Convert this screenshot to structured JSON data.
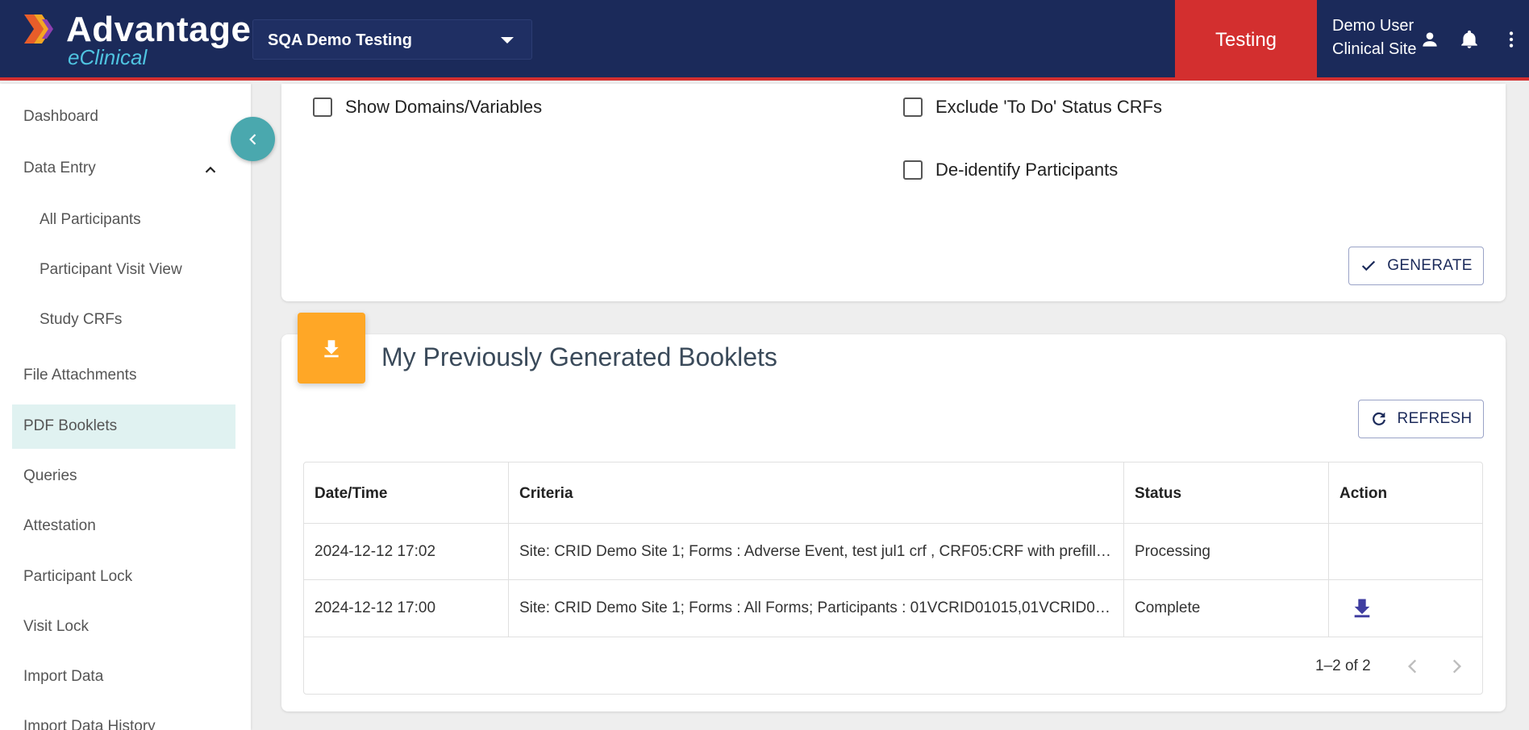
{
  "header": {
    "logo_title": "Advantage",
    "logo_subtitle": "eClinical",
    "study_selector": "SQA Demo Testing",
    "environment": "Testing",
    "user_name": "Demo User",
    "user_site": "Clinical Site",
    "icons": [
      "person-icon",
      "bell-icon",
      "more-vert-icon"
    ]
  },
  "sidebar": {
    "items": [
      {
        "label": "Dashboard"
      },
      {
        "label": "Data Entry"
      },
      {
        "label": "All Participants"
      },
      {
        "label": "Participant Visit View"
      },
      {
        "label": "Study CRFs"
      },
      {
        "label": "File Attachments"
      },
      {
        "label": "PDF Booklets",
        "active": true
      },
      {
        "label": "Queries"
      },
      {
        "label": "Attestation"
      },
      {
        "label": "Participant Lock"
      },
      {
        "label": "Visit Lock"
      },
      {
        "label": "Import Data"
      },
      {
        "label": "Import Data History"
      }
    ]
  },
  "options": {
    "show_domains": "Show Domains/Variables",
    "exclude_todo": "Exclude 'To Do' Status CRFs",
    "deidentify": "De-identify Participants",
    "generate_label": "GENERATE"
  },
  "booklets": {
    "title": "My Previously Generated Booklets",
    "refresh_label": "REFRESH",
    "columns": [
      "Date/Time",
      "Criteria",
      "Status",
      "Action"
    ],
    "rows": [
      {
        "datetime": "2024-12-12 17:02",
        "criteria": "Site: CRID Demo Site 1; Forms : Adverse Event, test jul1 crf , CRF05:CRF with prefill dat...",
        "status": "Processing"
      },
      {
        "datetime": "2024-12-12 17:00",
        "criteria": "Site: CRID Demo Site 1; Forms : All Forms; Participants : 01VCRID01015,01VCRID0101...",
        "status": "Complete"
      }
    ],
    "pagination": "1–2 of 2"
  },
  "colors": {
    "header_bg": "#1b2a5a",
    "accent_red": "#d32f2f",
    "teal": "#4aa8ae",
    "orange": "#ffa726",
    "active_nav": "#e0f2f1"
  }
}
